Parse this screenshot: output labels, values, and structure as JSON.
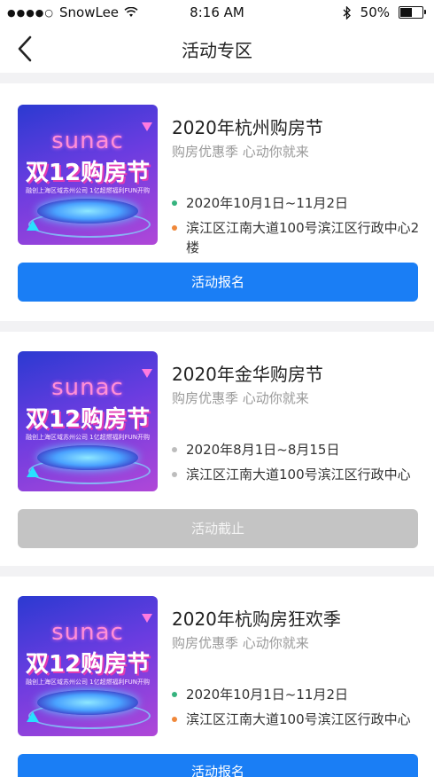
{
  "status_bar": {
    "carrier": "SnowLee",
    "signal_dots": "●●●●○",
    "time": "8:16 AM",
    "battery": "50%",
    "battery_level": 0.5
  },
  "nav": {
    "title": "活动专区"
  },
  "colors": {
    "primary_button": "#1a7ef5",
    "disabled_button": "#c4c4c4",
    "date_bullet": "#36b37e",
    "address_bullet": "#f0883a"
  },
  "poster": {
    "brand": "sunac",
    "headline": "双12购房节",
    "tagline": "融创上海区域苏州公司 1亿超燃福利FUN开购"
  },
  "events": [
    {
      "title": "2020年杭州购房节",
      "subtitle": "购房优惠季  心动你就来",
      "date": "2020年10月1日~11月2日",
      "address": "滨江区江南大道100号滨江区行政中心2楼",
      "button_label": "活动报名",
      "status": "active"
    },
    {
      "title": "2020年金华购房节",
      "subtitle": "购房优惠季  心动你就来",
      "date": "2020年8月1日~8月15日",
      "address": "滨江区江南大道100号滨江区行政中心",
      "button_label": "活动截止",
      "status": "ended"
    },
    {
      "title": "2020年杭购房狂欢季",
      "subtitle": "购房优惠季  心动你就来",
      "date": "2020年10月1日~11月2日",
      "address": "滨江区江南大道100号滨江区行政中心",
      "button_label": "活动报名",
      "status": "active"
    }
  ]
}
